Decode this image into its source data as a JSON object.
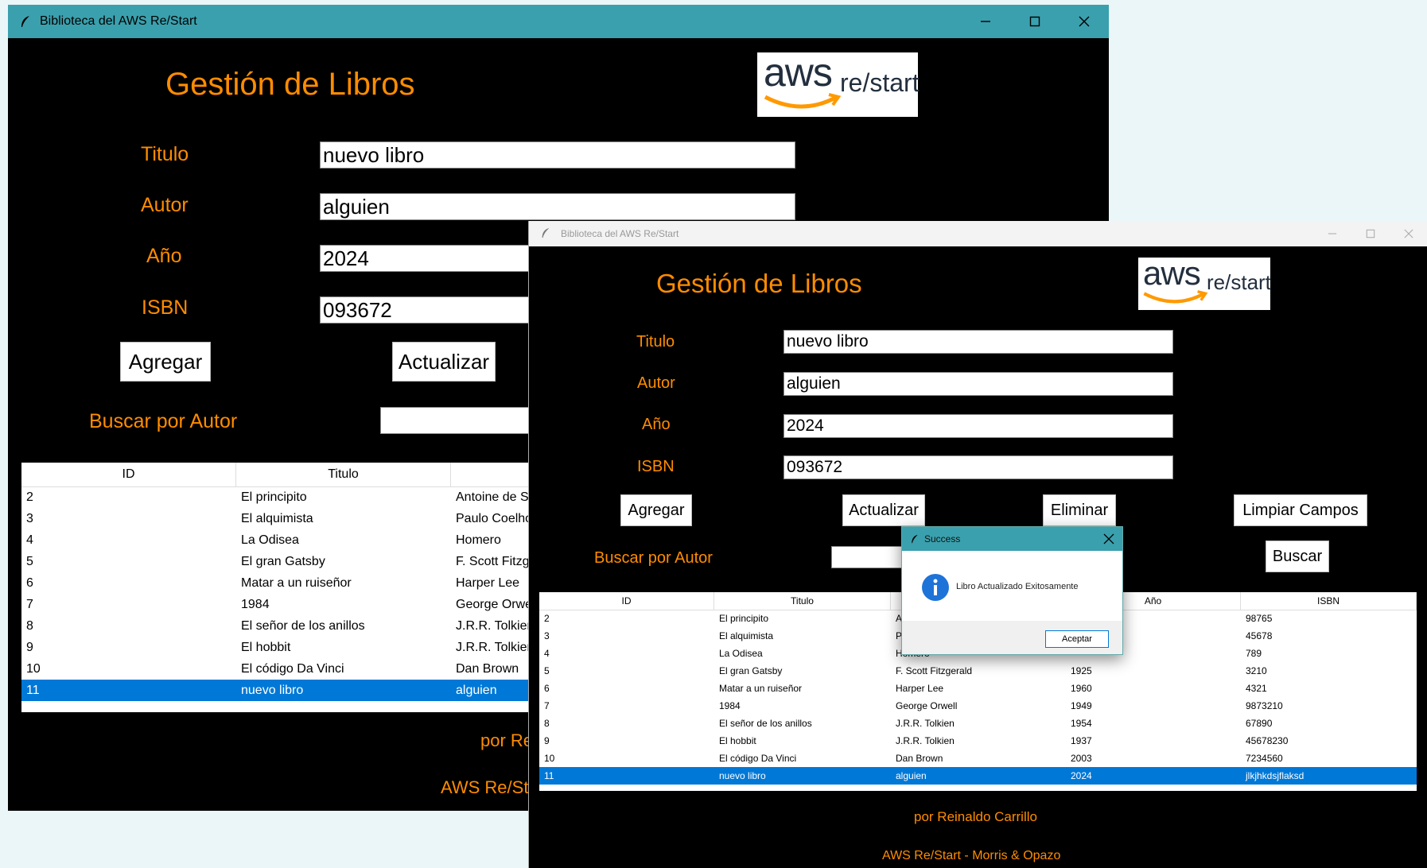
{
  "colors": {
    "accent": "#ff8c00",
    "titlebar": "#3aa0ad",
    "selection": "#0078d7"
  },
  "back_window": {
    "title": "Biblioteca del AWS Re/Start",
    "heading": "Gestión de Libros",
    "logo": {
      "brand": "aws",
      "suffix": "re/start"
    },
    "labels": {
      "titulo": "Titulo",
      "autor": "Autor",
      "anio": "Año",
      "isbn": "ISBN",
      "buscar": "Buscar por Autor"
    },
    "values": {
      "titulo": "nuevo libro",
      "autor": "alguien",
      "anio": "2024",
      "isbn": "093672",
      "buscar": ""
    },
    "buttons": {
      "agregar": "Agregar",
      "actualizar": "Actualizar"
    },
    "columns": [
      "ID",
      "Titulo",
      ""
    ],
    "rows": [
      [
        "2",
        "El principito",
        "Antoine de S"
      ],
      [
        "3",
        "El alquimista",
        "Paulo Coelho"
      ],
      [
        "4",
        "La Odisea",
        "Homero"
      ],
      [
        "5",
        "El gran Gatsby",
        "F. Scott Fitzg"
      ],
      [
        "6",
        "Matar a un ruiseñor",
        "Harper Lee"
      ],
      [
        "7",
        "1984",
        "George Orwe"
      ],
      [
        "8",
        "El señor de los anillos",
        "J.R.R. Tolkien"
      ],
      [
        "9",
        "El hobbit",
        "J.R.R. Tolkien"
      ],
      [
        "10",
        "El código Da Vinci",
        "Dan Brown"
      ],
      [
        "11",
        "nuevo libro",
        "alguien"
      ]
    ],
    "selected_row": 9,
    "footer_author": "por Re",
    "footer_credits": "AWS Re/St"
  },
  "front_window": {
    "title": "Biblioteca del AWS Re/Start",
    "heading": "Gestión de Libros",
    "logo": {
      "brand": "aws",
      "suffix": "re/start"
    },
    "labels": {
      "titulo": "Titulo",
      "autor": "Autor",
      "anio": "Año",
      "isbn": "ISBN",
      "buscar": "Buscar por Autor"
    },
    "values": {
      "titulo": "nuevo libro",
      "autor": "alguien",
      "anio": "2024",
      "isbn": "093672",
      "buscar": ""
    },
    "buttons": {
      "agregar": "Agregar",
      "actualizar": "Actualizar",
      "eliminar": "Eliminar",
      "limpiar": "Limpiar Campos",
      "buscar": "Buscar"
    },
    "columns": [
      "ID",
      "Titulo",
      "",
      "Año",
      "ISBN"
    ],
    "rows": [
      [
        "2",
        "El principito",
        "A",
        "",
        "98765"
      ],
      [
        "3",
        "El alquimista",
        "P",
        "",
        "45678"
      ],
      [
        "4",
        "La Odisea",
        "Homero",
        "",
        "789"
      ],
      [
        "5",
        "El gran Gatsby",
        "F. Scott Fitzgerald",
        "1925",
        "3210"
      ],
      [
        "6",
        "Matar a un ruiseñor",
        "Harper Lee",
        "1960",
        "4321"
      ],
      [
        "7",
        "1984",
        "George Orwell",
        "1949",
        "9873210"
      ],
      [
        "8",
        "El señor de los anillos",
        "J.R.R. Tolkien",
        "1954",
        "67890"
      ],
      [
        "9",
        "El hobbit",
        "J.R.R. Tolkien",
        "1937",
        "45678230"
      ],
      [
        "10",
        "El código Da Vinci",
        "Dan Brown",
        "2003",
        "7234560"
      ],
      [
        "11",
        "nuevo libro",
        "alguien",
        "2024",
        "jlkjhkdsjflaksd"
      ]
    ],
    "selected_row": 9,
    "footer_author": "por Reinaldo Carrillo",
    "footer_credits": "AWS Re/Start - Morris & Opazo"
  },
  "dialog": {
    "title": "Success",
    "message": "Libro Actualizado Exitosamente",
    "ok": "Aceptar"
  }
}
